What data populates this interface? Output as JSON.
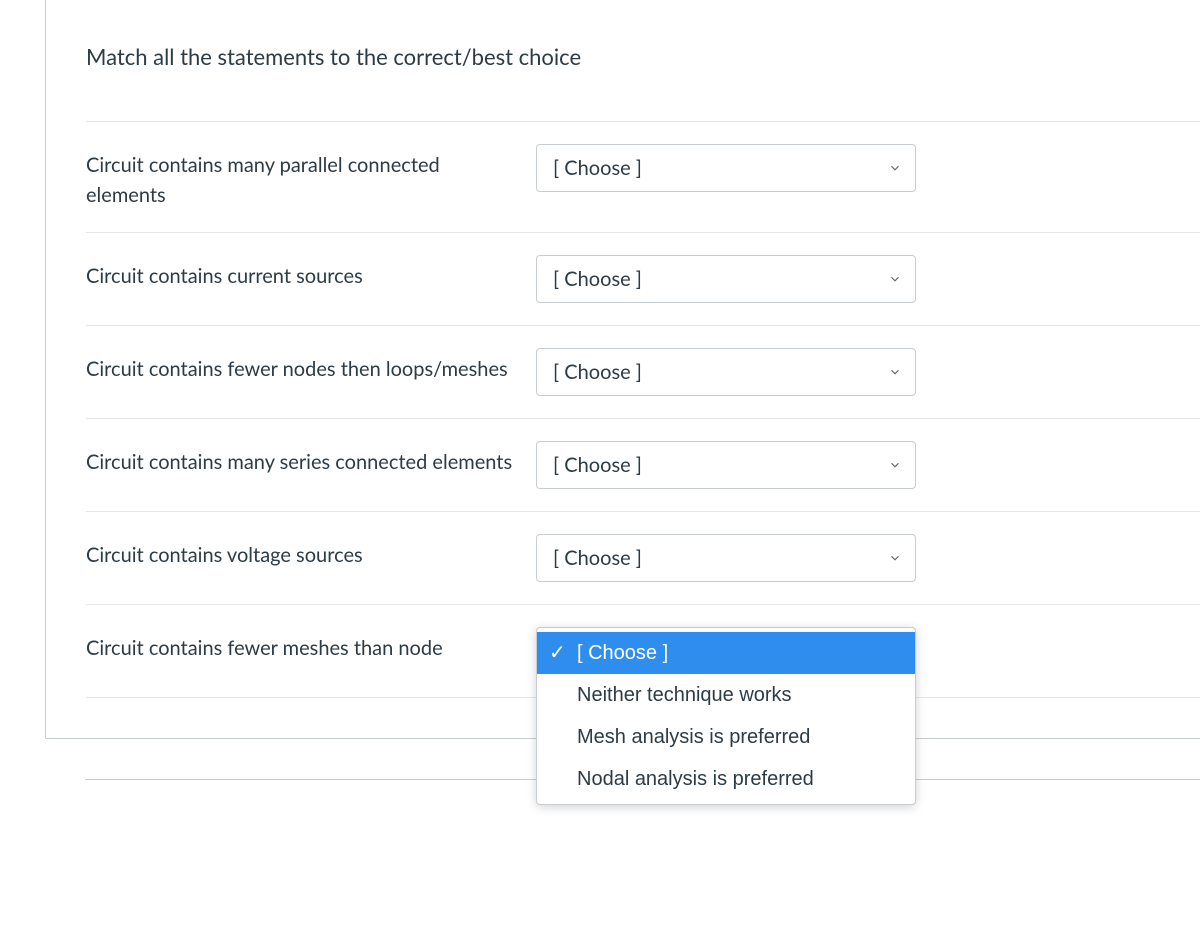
{
  "prompt": "Match all the statements to the correct/best choice",
  "placeholder": "[ Choose ]",
  "rows": [
    {
      "statement": "Circuit contains many parallel connected elements"
    },
    {
      "statement": "Circuit contains current sources"
    },
    {
      "statement": "Circuit contains fewer nodes then loops/meshes"
    },
    {
      "statement": "Circuit contains many series connected elements"
    },
    {
      "statement": "Circuit contains voltage sources"
    },
    {
      "statement": "Circuit contains fewer meshes than node"
    }
  ],
  "dropdown": {
    "options": [
      "[ Choose ]",
      "Neither technique works",
      "Mesh analysis is preferred",
      "Nodal analysis is preferred"
    ],
    "selected_index": 0
  }
}
